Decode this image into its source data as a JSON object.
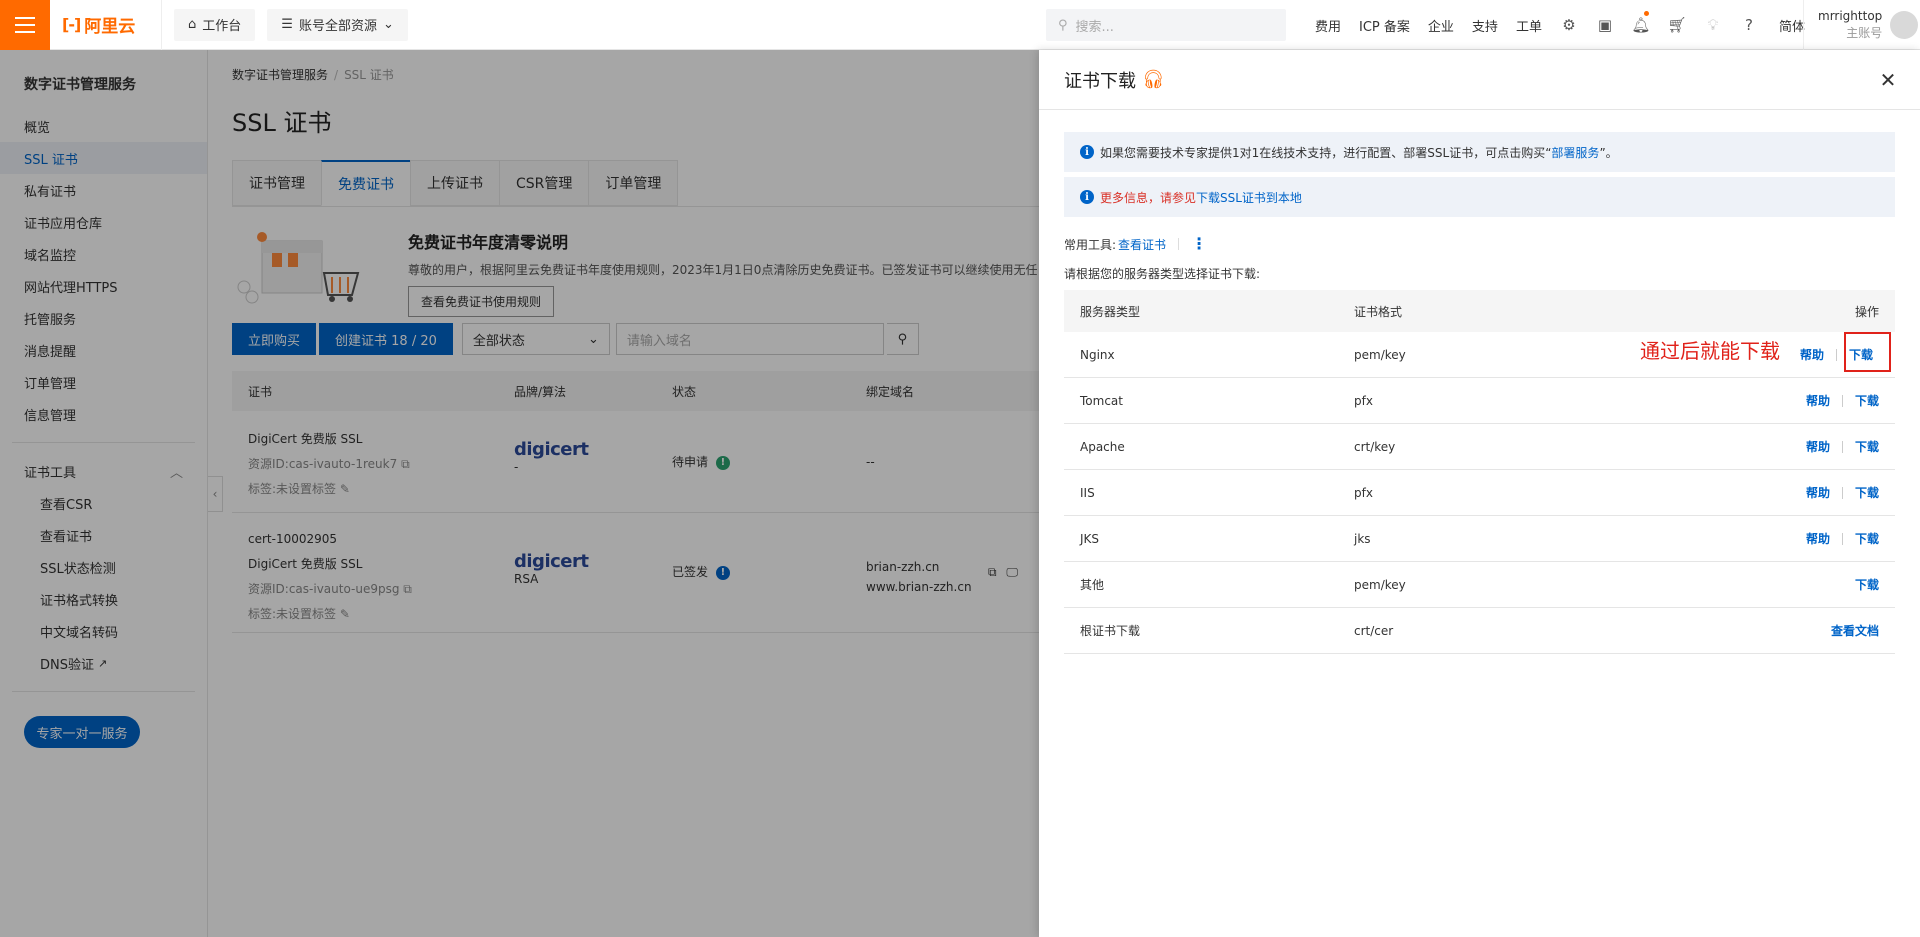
{
  "topbar": {
    "logo": "阿里云",
    "workbench": "工作台",
    "resources": "账号全部资源",
    "search_placeholder": "搜索...",
    "links": [
      "费用",
      "ICP 备案",
      "企业",
      "支持",
      "工单"
    ],
    "lang": "简体",
    "username": "mrrighttop",
    "account_type": "主账号"
  },
  "sidebar": {
    "title": "数字证书管理服务",
    "items": [
      "概览",
      "SSL 证书",
      "私有证书",
      "证书应用仓库",
      "域名监控",
      "网站代理HTTPS",
      "托管服务",
      "消息提醒",
      "订单管理",
      "信息管理"
    ],
    "tools_group": "证书工具",
    "tools": [
      "查看CSR",
      "查看证书",
      "SSL状态检测",
      "证书格式转换",
      "中文域名转码",
      "DNS验证"
    ],
    "consult_button": "专家一对一服务"
  },
  "main": {
    "breadcrumb": [
      "数字证书管理服务",
      "SSL 证书"
    ],
    "title": "SSL 证书",
    "tabs": [
      "证书管理",
      "免费证书",
      "上传证书",
      "CSR管理",
      "订单管理"
    ],
    "banner": {
      "title": "免费证书年度清零说明",
      "desc": "尊敬的用户，根据阿里云免费证书年度使用规则，2023年1月1日0点清除历史免费证书。已签发证书可以继续使用无任",
      "button": "查看免费证书使用规则"
    },
    "actions": {
      "buy": "立即购买",
      "create": "创建证书 18 / 20",
      "status_select": "全部状态",
      "domain_placeholder": "请输入域名"
    },
    "columns": [
      "证书",
      "品牌/算法",
      "状态",
      "绑定域名"
    ],
    "rows": [
      {
        "cert_name": "",
        "product": "DigiCert 免费版 SSL",
        "resource_id": "资源ID:cas-ivauto-1reuk7",
        "tag": "标签:未设置标签",
        "brand": "digicert",
        "algo": "-",
        "status": "待申请",
        "status_color": "#2ba471",
        "domains": [
          "--"
        ]
      },
      {
        "cert_name": "cert-10002905",
        "product": "DigiCert 免费版 SSL",
        "resource_id": "资源ID:cas-ivauto-ue9psg",
        "tag": "标签:未设置标签",
        "brand": "digicert",
        "algo": "RSA",
        "status": "已签发",
        "status_color": "#0064c8",
        "domains": [
          "brian-zzh.cn",
          "www.brian-zzh.cn"
        ]
      }
    ]
  },
  "drawer": {
    "title": "证书下载",
    "notice1_prefix": "如果您需要技术专家提供1对1在线技术支持，进行配置、部署SSL证书，可点击购买“",
    "notice1_link": "部署服务",
    "notice1_suffix": "”。",
    "notice2_red": "更多信息，请参见",
    "notice2_link": "下载SSL证书到本地",
    "tools_label": "常用工具:",
    "tools_link": "查看证书",
    "hint": "请根据您的服务器类型选择证书下载:",
    "columns": [
      "服务器类型",
      "证书格式",
      "操作"
    ],
    "rows": [
      {
        "server": "Nginx",
        "format": "pem/key",
        "help": "帮助",
        "action": "下载"
      },
      {
        "server": "Tomcat",
        "format": "pfx",
        "help": "帮助",
        "action": "下载"
      },
      {
        "server": "Apache",
        "format": "crt/key",
        "help": "帮助",
        "action": "下载"
      },
      {
        "server": "IIS",
        "format": "pfx",
        "help": "帮助",
        "action": "下载"
      },
      {
        "server": "JKS",
        "format": "jks",
        "help": "帮助",
        "action": "下载"
      },
      {
        "server": "其他",
        "format": "pem/key",
        "help": "",
        "action": "下载"
      },
      {
        "server": "根证书下载",
        "format": "crt/cer",
        "help": "",
        "action": "查看文档"
      }
    ]
  },
  "annotation": "通过后就能下载"
}
